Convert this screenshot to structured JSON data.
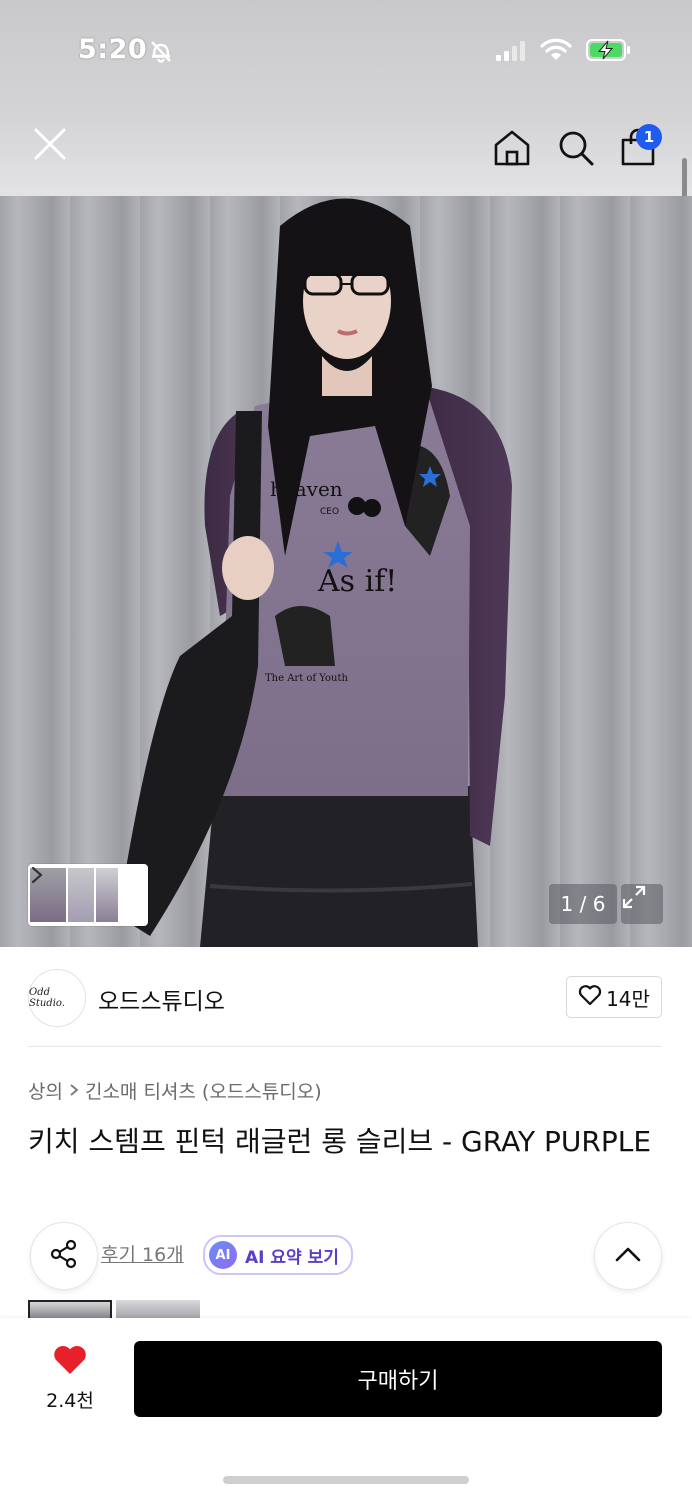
{
  "status_bar": {
    "time": "5:20",
    "icons": [
      "bell-off-icon",
      "signal-icon",
      "wifi-icon",
      "battery-charging-icon"
    ]
  },
  "nav": {
    "cart_badge": "1",
    "icons": [
      "close-icon",
      "home-icon",
      "search-icon",
      "cart-icon"
    ]
  },
  "gallery": {
    "counter": "1 / 6",
    "icons": [
      "chevron-right-icon",
      "expand-icon"
    ]
  },
  "brand": {
    "logo_text": "Odd Studio.",
    "name": "오드스튜디오",
    "like_count": "14만"
  },
  "breadcrumb": {
    "level1": "상의",
    "level2": "긴소매 티셔츠 (오드스튜디오)"
  },
  "product": {
    "title": "키치 스템프 핀턱 래글런 롱 슬리브 - GRAY PURPLE"
  },
  "actions": {
    "review_link": "후기 16개",
    "ai_badge": "AI",
    "ai_summary": "AI 요약 보기"
  },
  "bottom_bar": {
    "wish_count": "2.4천",
    "buy_label": "구매하기"
  },
  "colors": {
    "accent_blue": "#1e5cf0",
    "wish_red": "#e8202a",
    "buy_button": "#000000",
    "ai_purple": "#5a3fc4"
  }
}
